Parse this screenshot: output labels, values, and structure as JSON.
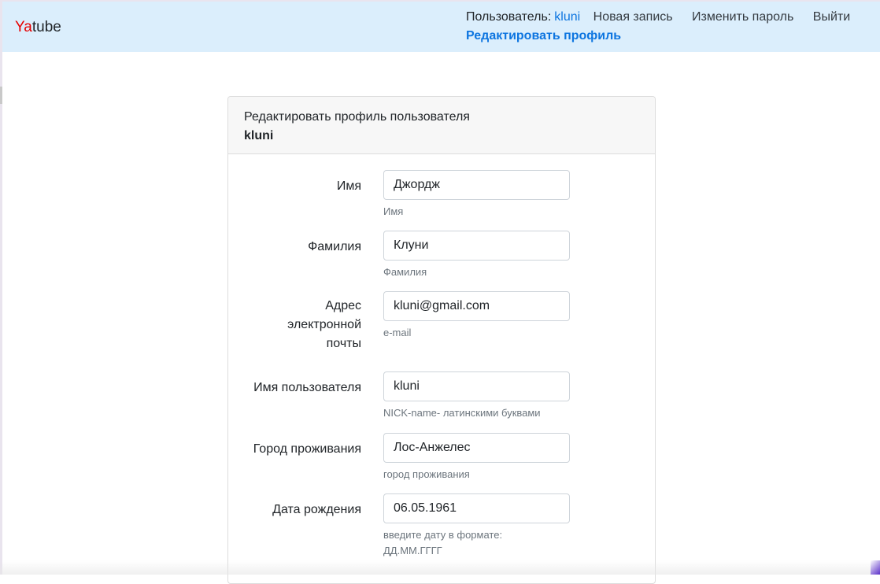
{
  "navbar": {
    "brand_accent": "Ya",
    "brand_rest": "tube",
    "user_label": "Пользователь:",
    "user_name": "kluni",
    "new_post": "Новая запись",
    "change_password": "Изменить пароль",
    "logout": "Выйти",
    "edit_profile": "Редактировать профиль"
  },
  "card": {
    "title": "Редактировать профиль пользователя",
    "username": "kluni"
  },
  "fields": [
    {
      "label": "Имя",
      "value": "Джордж",
      "help": "Имя"
    },
    {
      "label": "Фамилия",
      "value": "Клуни",
      "help": "Фамилия"
    },
    {
      "label": "Адрес электронной почты",
      "value": "kluni@gmail.com",
      "help": "e-mail"
    },
    {
      "label": "Имя пользователя",
      "value": "kluni",
      "help": "NICK-name- латинскими буквами"
    },
    {
      "label": "Город проживания",
      "value": "Лос-Анжелес",
      "help": "город проживания"
    },
    {
      "label": "Дата рождения",
      "value": "06.05.1961",
      "help": "введите дату в формате: ДД.ММ.ГГГГ"
    }
  ],
  "colors": {
    "navbar_bg": "#dbeefc",
    "link_blue": "#0d75e0",
    "brand_red": "#e60000"
  }
}
